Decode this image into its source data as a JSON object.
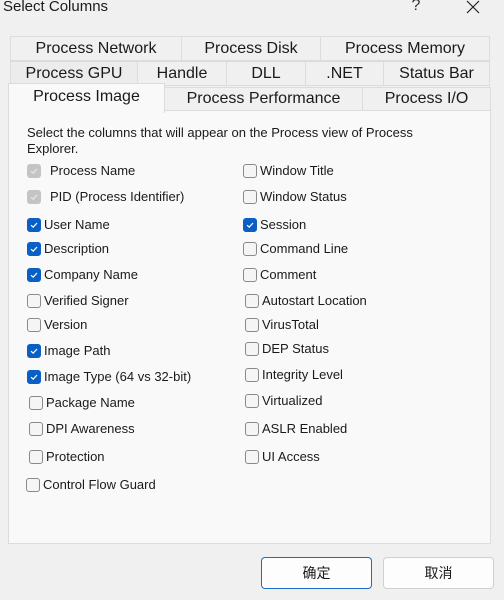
{
  "window": {
    "title": "Select Columns",
    "help_label": "?",
    "close_icon": "close-icon"
  },
  "tabs": {
    "row1": [
      "Process Network",
      "Process Disk",
      "Process Memory"
    ],
    "row2": [
      "Process GPU",
      "Handle",
      "DLL",
      ".NET",
      "Status Bar"
    ],
    "row3": [
      "Process Image",
      "Process Performance",
      "Process I/O"
    ],
    "active": "Process Image"
  },
  "panel": {
    "description": "Select the columns that will appear on the Process view of Process Explorer.",
    "left_column": [
      {
        "label": "Process Name",
        "checked": true,
        "disabled": true
      },
      {
        "label": "PID (Process Identifier)",
        "checked": true,
        "disabled": true
      },
      {
        "label": "User Name",
        "checked": true,
        "disabled": false
      },
      {
        "label": "Description",
        "checked": true,
        "disabled": false
      },
      {
        "label": "Company Name",
        "checked": true,
        "disabled": false
      },
      {
        "label": "Verified Signer",
        "checked": false,
        "disabled": false
      },
      {
        "label": "Version",
        "checked": false,
        "disabled": false
      },
      {
        "label": "Image Path",
        "checked": true,
        "disabled": false
      },
      {
        "label": "Image Type (64 vs 32-bit)",
        "checked": true,
        "disabled": false
      },
      {
        "label": "Package Name",
        "checked": false,
        "disabled": false
      },
      {
        "label": "DPI Awareness",
        "checked": false,
        "disabled": false
      },
      {
        "label": "Protection",
        "checked": false,
        "disabled": false
      },
      {
        "label": "Control Flow Guard",
        "checked": false,
        "disabled": false
      }
    ],
    "right_column": [
      {
        "label": "Window Title",
        "checked": false,
        "disabled": false
      },
      {
        "label": "Window Status",
        "checked": false,
        "disabled": false
      },
      {
        "label": "Session",
        "checked": true,
        "disabled": false
      },
      {
        "label": "Command Line",
        "checked": false,
        "disabled": false
      },
      {
        "label": "Comment",
        "checked": false,
        "disabled": false
      },
      {
        "label": "Autostart Location",
        "checked": false,
        "disabled": false
      },
      {
        "label": "VirusTotal",
        "checked": false,
        "disabled": false
      },
      {
        "label": "DEP Status",
        "checked": false,
        "disabled": false
      },
      {
        "label": "Integrity Level",
        "checked": false,
        "disabled": false
      },
      {
        "label": "Virtualized",
        "checked": false,
        "disabled": false
      },
      {
        "label": "ASLR Enabled",
        "checked": false,
        "disabled": false
      },
      {
        "label": "UI Access",
        "checked": false,
        "disabled": false
      }
    ]
  },
  "buttons": {
    "ok": "确定",
    "cancel": "取消"
  },
  "colors": {
    "accent": "#0a5fc4",
    "disabled_check": "#c4c4c4"
  }
}
